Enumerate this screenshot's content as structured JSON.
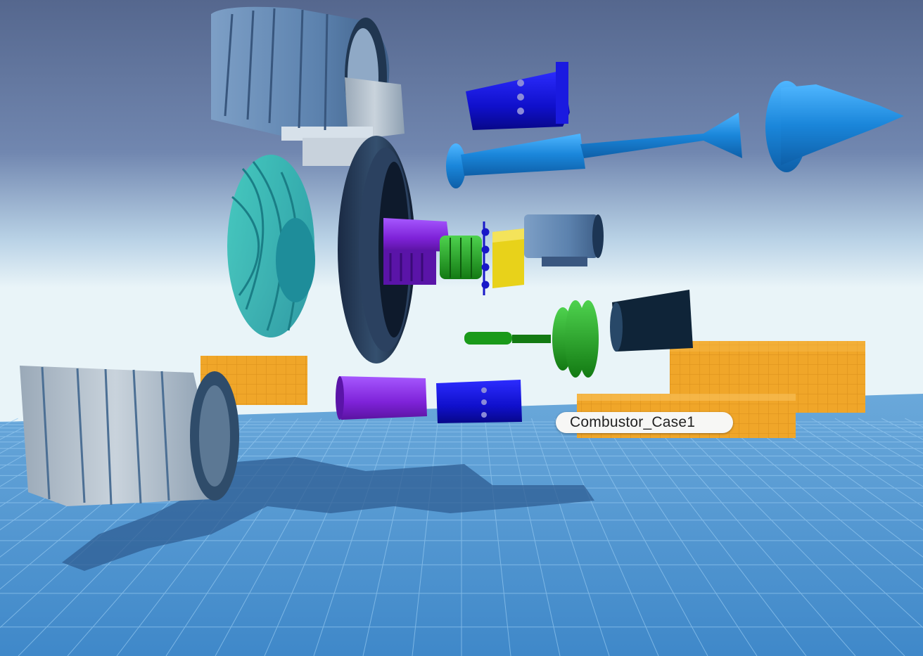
{
  "scene": {
    "hover_label": "Combustor_Case1",
    "colors": {
      "sky_top": "#56688f",
      "sky_horizon": "#e9f4f8",
      "floor": "#4a8fcc",
      "grid_line": "#8fc3ee",
      "crate": "#f0a629",
      "fan_case": "#6f94bf",
      "fan_blades": "#2fb0b0",
      "shaft_blue": "#1f8fe0",
      "compressor_purple": "#8a2be2",
      "combustor_blue": "#1010d0",
      "turbine_green": "#20a020",
      "combustor_yellow": "#e8d21a"
    }
  },
  "objects": [
    {
      "name": "fan-case-upper",
      "icon": "engine-casing"
    },
    {
      "name": "fan-blades",
      "icon": "fan-rotor"
    },
    {
      "name": "bypass-ring",
      "icon": "ring"
    },
    {
      "name": "combustor-case-upper",
      "icon": "combustor-case"
    },
    {
      "name": "low-pressure-shaft",
      "icon": "shaft-with-cone"
    },
    {
      "name": "hp-compressor",
      "icon": "compressor"
    },
    {
      "name": "hp-turbine",
      "icon": "turbine"
    },
    {
      "name": "combustor-liner",
      "icon": "combustor"
    },
    {
      "name": "turbine-case",
      "icon": "turbine-case"
    },
    {
      "name": "lp-turbine-shaft",
      "icon": "turbine-rotor"
    },
    {
      "name": "compressor-case-lower",
      "icon": "compressor-case"
    },
    {
      "name": "combustor-case-lower",
      "icon": "combustor-case"
    },
    {
      "name": "fan-case-lower",
      "icon": "engine-casing"
    },
    {
      "name": "crate-left",
      "icon": "grid-crate"
    },
    {
      "name": "crate-right-back",
      "icon": "grid-crate"
    },
    {
      "name": "crate-right-front",
      "icon": "grid-crate"
    }
  ]
}
